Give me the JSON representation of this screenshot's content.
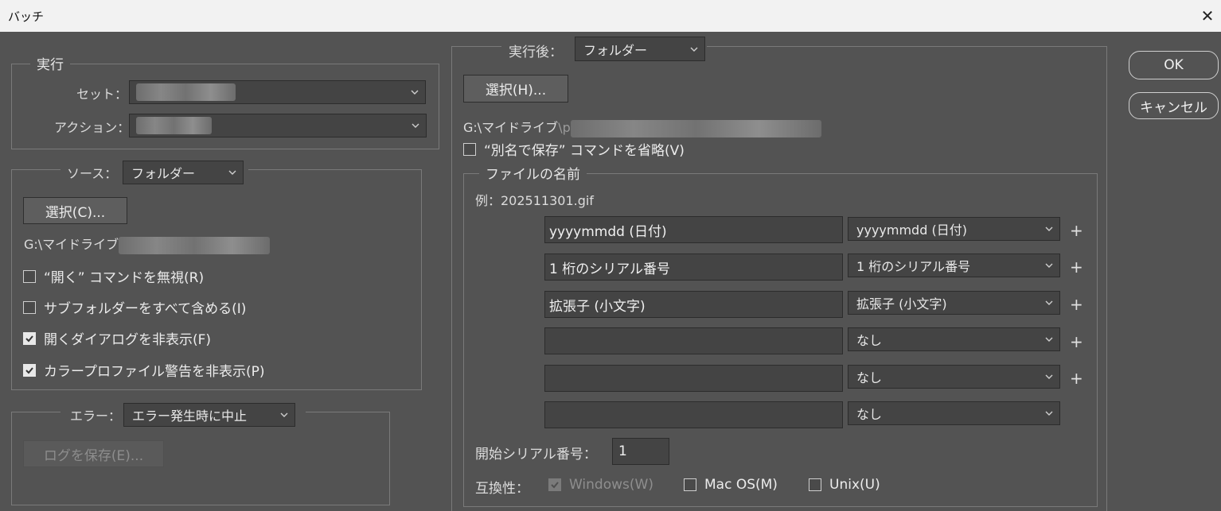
{
  "window": {
    "title": "バッチ",
    "close_icon": "✕"
  },
  "play": {
    "legend": "実行",
    "set_label": "セット：",
    "action_label": "アクション："
  },
  "source": {
    "label": "ソース：",
    "value": "フォルダー",
    "choose_button": "選択(C)...",
    "path_prefix": "G:\\マイドライブ",
    "checkboxes": [
      {
        "label": "“開く” コマンドを無視(R)",
        "checked": false
      },
      {
        "label": "サブフォルダーをすべて含める(I)",
        "checked": false
      },
      {
        "label": "開くダイアログを非表示(F)",
        "checked": true
      },
      {
        "label": "カラープロファイル警告を非表示(P)",
        "checked": true
      }
    ]
  },
  "errors": {
    "label": "エラー：",
    "value": "エラー発生時に中止",
    "save_log_button": "ログを保存(E)..."
  },
  "destination": {
    "label": "実行後：",
    "value": "フォルダー",
    "choose_button": "選択(H)...",
    "path_prefix": "G:\\マイドライブ",
    "path_partial": "\\p",
    "override_checkbox": "“別名で保存” コマンドを省略(V)",
    "override_checked": false
  },
  "file_naming": {
    "legend": "ファイルの名前",
    "example": "例：202511301.gif",
    "rows": [
      {
        "input": "yyyymmdd (日付)",
        "select": "yyyymmdd (日付)",
        "plus": "+"
      },
      {
        "input": "1 桁のシリアル番号",
        "select": "1 桁のシリアル番号",
        "plus": "+"
      },
      {
        "input": "拡張子 (小文字)",
        "select": "拡張子 (小文字)",
        "plus": "+"
      },
      {
        "input": "",
        "select": "なし",
        "plus": "+"
      },
      {
        "input": "",
        "select": "なし",
        "plus": "+"
      },
      {
        "input": "",
        "select": "なし",
        "plus": ""
      }
    ],
    "serial_label": "開始シリアル番号：",
    "serial_value": "1",
    "compat_label": "互換性：",
    "compat": [
      {
        "label": "Windows(W)",
        "checked": true,
        "disabled": true
      },
      {
        "label": "Mac OS(M)",
        "checked": false,
        "disabled": false
      },
      {
        "label": "Unix(U)",
        "checked": false,
        "disabled": false
      }
    ]
  },
  "buttons": {
    "ok": "OK",
    "cancel": "キャンセル"
  }
}
